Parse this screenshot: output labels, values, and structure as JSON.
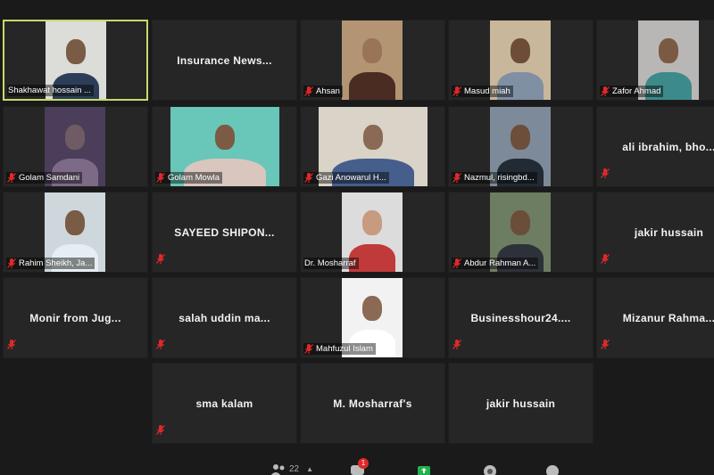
{
  "meeting": {
    "participants": [
      {
        "name": "Shakhawat hossain ...",
        "has_video": true,
        "active": true,
        "muted": false
      },
      {
        "name": "Insurance News...",
        "has_video": false,
        "muted": false
      },
      {
        "name": "Ahsan",
        "has_video": true,
        "muted": true
      },
      {
        "name": "Masud miah",
        "has_video": true,
        "muted": true
      },
      {
        "name": "Zafor Ahmad",
        "has_video": true,
        "muted": true
      },
      {
        "name": "Golam Samdani",
        "has_video": true,
        "muted": true
      },
      {
        "name": "Golam Mowla",
        "has_video": true,
        "muted": true
      },
      {
        "name": "Gazi Anowarul H...",
        "has_video": true,
        "muted": true
      },
      {
        "name": "Nazmul, risingbd...",
        "has_video": true,
        "muted": true
      },
      {
        "name": "ali ibrahim, bho...",
        "has_video": false,
        "muted": true
      },
      {
        "name": "Rahim Sheikh, Ja...",
        "has_video": true,
        "muted": true
      },
      {
        "name": "SAYEED SHIPON...",
        "has_video": false,
        "muted": true
      },
      {
        "name": "Dr. Mosharraf",
        "has_video": true,
        "muted": false
      },
      {
        "name": "Abdur Rahman A...",
        "has_video": true,
        "muted": true
      },
      {
        "name": "jakir hussain",
        "has_video": false,
        "muted": true
      },
      {
        "name": "Monir from Jug...",
        "has_video": false,
        "muted": true
      },
      {
        "name": "salah uddin ma...",
        "has_video": false,
        "muted": true
      },
      {
        "name": "Mahfuzul Islam",
        "has_video": true,
        "muted": true
      },
      {
        "name": "Businesshour24....",
        "has_video": false,
        "muted": true
      },
      {
        "name": "Mizanur Rahma...",
        "has_video": false,
        "muted": true
      },
      {
        "name": "sma kalam",
        "has_video": false,
        "muted": true
      },
      {
        "name": "M. Mosharraf's",
        "has_video": false,
        "muted": false
      },
      {
        "name": "jakir hussain",
        "has_video": false,
        "muted": false
      }
    ]
  },
  "toolbar": {
    "participants_count": "22",
    "chat_badge": "1"
  },
  "colors": {
    "background": "#1a1a1a",
    "tile": "#262626",
    "active_border": "#c9d96b",
    "muted_icon": "#e02828",
    "share_green": "#22b14c"
  }
}
